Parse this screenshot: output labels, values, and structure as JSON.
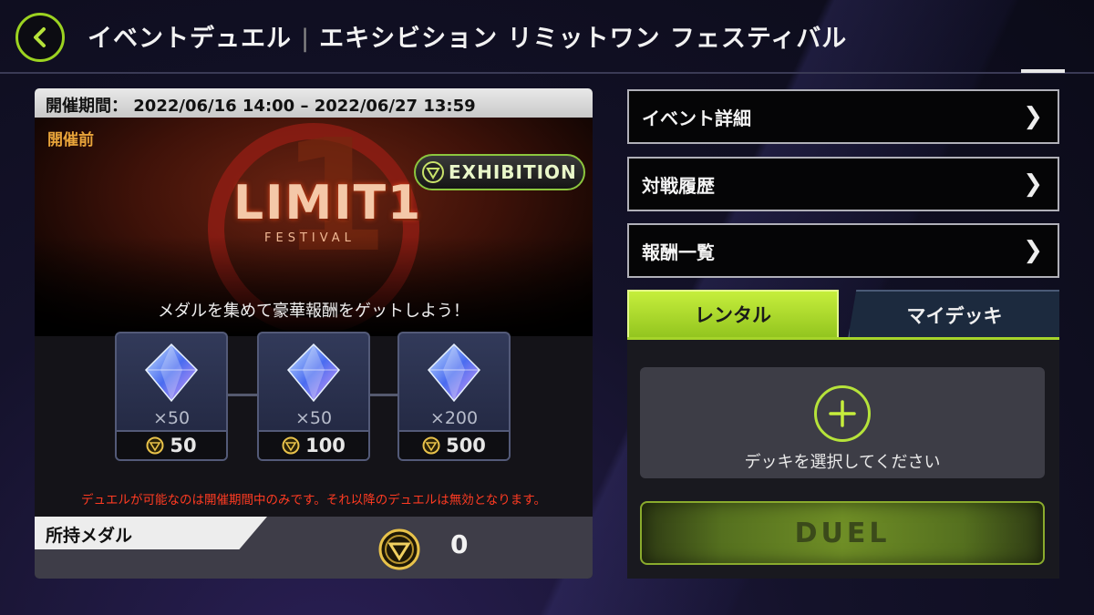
{
  "header": {
    "title_left": "イベントデュエル",
    "title_separator": "|",
    "title_right": "エキシビション リミットワン フェスティバル",
    "back_icon": "chevron-left-icon"
  },
  "event": {
    "period_label": "開催期間：",
    "period_value": "2022/06/16 14:00 – 2022/06/27 13:59",
    "status": "開催前",
    "logo_main": "LIMIT1",
    "logo_sub": "FESTIVAL",
    "badge": "EXHIBITION",
    "tagline": "メダルを集めて豪華報酬をゲットしよう！",
    "notice": "デュエルが可能なのは開催期間中のみです。それ以降のデュエルは無効となります。"
  },
  "rewards": [
    {
      "quantity": "×50",
      "cost": "50"
    },
    {
      "quantity": "×50",
      "cost": "100"
    },
    {
      "quantity": "×200",
      "cost": "500"
    }
  ],
  "medals": {
    "label": "所持メダル",
    "count": "0"
  },
  "menu": [
    {
      "label": "イベント詳細"
    },
    {
      "label": "対戦履歴"
    },
    {
      "label": "報酬一覧"
    }
  ],
  "tabs": {
    "rental": "レンタル",
    "mydeck": "マイデッキ"
  },
  "deck": {
    "prompt": "デッキを選択してください",
    "duel_label": "DUEL"
  },
  "colors": {
    "accent": "#a6d42a",
    "notice": "#ff3b22",
    "status": "#e8a43a"
  }
}
